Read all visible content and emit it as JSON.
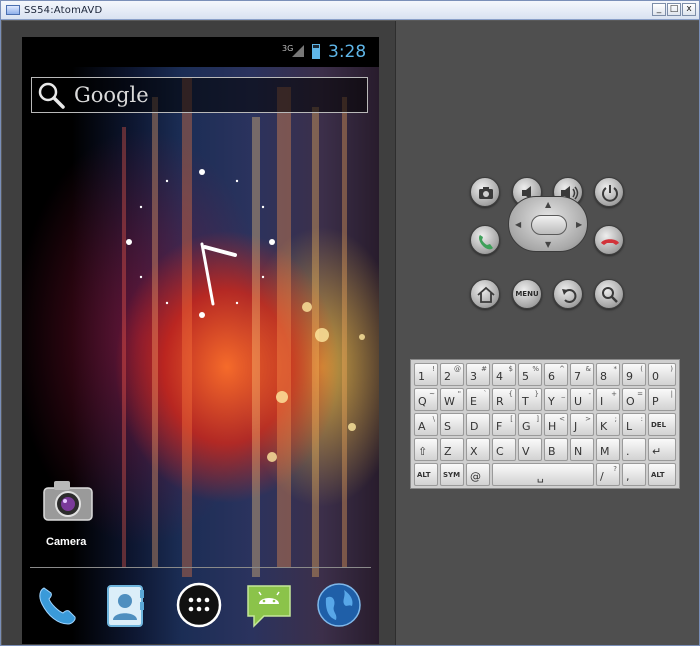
{
  "window": {
    "title": "SS54:AtomAVD",
    "controls": {
      "minimize": "_",
      "maximize": "□",
      "close": "x"
    }
  },
  "status_bar": {
    "network": "3G",
    "time": "3:28",
    "battery_color": "#5fb6e8"
  },
  "search": {
    "placeholder": "Google",
    "icon": "search-icon"
  },
  "home": {
    "widget": "analog-clock-widget",
    "clock": {
      "hour_hand_value": 3.47,
      "minute_hand_value": 28
    },
    "shortcuts": [
      {
        "label": "Camera",
        "icon": "camera-icon"
      }
    ]
  },
  "dock": {
    "items": [
      {
        "name": "phone-icon"
      },
      {
        "name": "contacts-icon"
      },
      {
        "name": "app-drawer-icon"
      },
      {
        "name": "messaging-icon"
      },
      {
        "name": "browser-icon"
      }
    ]
  },
  "hardware": {
    "row1": [
      "camera-button",
      "volume-down-button",
      "volume-up-button",
      "power-button"
    ],
    "row2": [
      "call-button",
      "dpad",
      "end-call-button"
    ],
    "row3": [
      "home-button",
      "menu-button",
      "back-button",
      "search-button"
    ],
    "menu_label": "MENU",
    "call_color": "#3fa05a",
    "end_call_color": "#d2333a"
  },
  "keyboard": {
    "rows": [
      [
        {
          "m": "1",
          "s": "!"
        },
        {
          "m": "2",
          "s": "@"
        },
        {
          "m": "3",
          "s": "#"
        },
        {
          "m": "4",
          "s": "$"
        },
        {
          "m": "5",
          "s": "%"
        },
        {
          "m": "6",
          "s": "^"
        },
        {
          "m": "7",
          "s": "&"
        },
        {
          "m": "8",
          "s": "*"
        },
        {
          "m": "9",
          "s": "("
        },
        {
          "m": "0",
          "s": ")"
        }
      ],
      [
        {
          "m": "Q",
          "s": "~"
        },
        {
          "m": "W",
          "s": "\""
        },
        {
          "m": "E",
          "s": "`"
        },
        {
          "m": "R",
          "s": "{"
        },
        {
          "m": "T",
          "s": "}"
        },
        {
          "m": "Y",
          "s": "_"
        },
        {
          "m": "U",
          "s": "-"
        },
        {
          "m": "I",
          "s": "+"
        },
        {
          "m": "O",
          "s": "="
        },
        {
          "m": "P",
          "s": "|"
        }
      ],
      [
        {
          "m": "A",
          "s": "\\"
        },
        {
          "m": "S",
          "s": ""
        },
        {
          "m": "D",
          "s": ""
        },
        {
          "m": "F",
          "s": "["
        },
        {
          "m": "G",
          "s": "]"
        },
        {
          "m": "H",
          "s": "<"
        },
        {
          "m": "J",
          "s": ">"
        },
        {
          "m": "K",
          "s": ";"
        },
        {
          "m": "L",
          "s": ":"
        },
        {
          "m": "DEL",
          "s": ""
        }
      ],
      [
        {
          "m": "⇧",
          "s": ""
        },
        {
          "m": "Z",
          "s": ""
        },
        {
          "m": "X",
          "s": ""
        },
        {
          "m": "C",
          "s": ""
        },
        {
          "m": "V",
          "s": ""
        },
        {
          "m": "B",
          "s": ""
        },
        {
          "m": "N",
          "s": ""
        },
        {
          "m": "M",
          "s": ""
        },
        {
          "m": ".",
          "s": ""
        },
        {
          "m": "↵",
          "s": ""
        }
      ],
      [
        {
          "m": "ALT",
          "s": ""
        },
        {
          "m": "SYM",
          "s": ""
        },
        {
          "m": "@",
          "s": ""
        },
        {
          "m": "␣",
          "s": ""
        },
        {
          "m": "/",
          "s": "?"
        },
        {
          "m": ",",
          "s": ""
        },
        {
          "m": "ALT",
          "s": ""
        }
      ]
    ]
  }
}
